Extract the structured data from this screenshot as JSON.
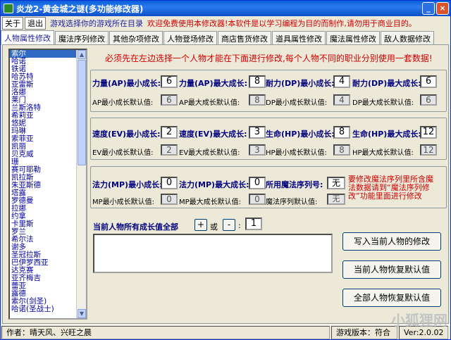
{
  "window": {
    "title": "炎龙2-黄金城之谜(多功能修改器)"
  },
  "menu": {
    "item1": "关于",
    "item2": "退出",
    "hint": "游戏选择你的游戏所在目录",
    "welcome": "欢迎免费使用本修改器!本软件是以学习编程为目的而制作,请勿用于商业目的。"
  },
  "tabs": [
    "人物属性修改",
    "魔法序列修改",
    "其他杂项修改",
    "人物登场修改",
    "商店售货修改",
    "道具属性修改",
    "魔法属性修改",
    "敌人数据修改"
  ],
  "characters": [
    "索尔",
    "哈诺",
    "铁诺",
    "哈苏特",
    "亚雷斯",
    "洛娜",
    "莱门",
    "兰斯洛特",
    "希莉亚",
    "悠妮",
    "玛琳",
    "索菲亚",
    "凯丽",
    "贝克威",
    "珊",
    "赛可耶勒",
    "凯拉斯",
    "朱亚斯德",
    "塔露",
    "罗德曼",
    "拉娜",
    "约拿",
    "卡里斯",
    "罗兰",
    "希尔法",
    "谢多",
    "圣冠拉斯",
    "巴伊罗西亚",
    "达克赛",
    "亚齐梅吉",
    "蕾亚",
    "露德",
    "索尔(剑圣)",
    "哈诺(圣战士)"
  ],
  "selected_index": 0,
  "warning": "必须先在左边选择一个人物才能在下面进行修改,每个人物不同的职业分别使用一套数据!",
  "stats": {
    "ap_min_label": "力量(AP)最小成长:",
    "ap_min": "6",
    "ap_max_label": "力量(AP)最大成长:",
    "ap_max": "8",
    "dp_min_label": "耐力(DP)最小成长:",
    "dp_min": "4",
    "dp_max_label": "耐力(DP)最大成长:",
    "dp_max": "6",
    "ap_min_def_label": "AP最小成长默认值:",
    "ap_min_def": "6",
    "ap_max_def_label": "AP最大成长默认值:",
    "ap_max_def": "8",
    "dp_min_def_label": "DP最小成长默认值:",
    "dp_min_def": "4",
    "dp_max_def_label": "DP最大成长默认值:",
    "dp_max_def": "6",
    "ev_min_label": "速度(EV)最小成长:",
    "ev_min": "2",
    "ev_max_label": "速度(EV)最大成长:",
    "ev_max": "3",
    "hp_min_label": "生命(HP)最小成长:",
    "hp_min": "8",
    "hp_max_label": "生命(HP)最大成长:",
    "hp_max": "12",
    "ev_min_def_label": "EV最小成长默认值:",
    "ev_min_def": "2",
    "ev_max_def_label": "EV最大成长默认值:",
    "ev_max_def": "3",
    "hp_min_def_label": "HP最小成长默认值:",
    "hp_min_def": "8",
    "hp_max_def_label": "HP最大成长默认值:",
    "hp_max_def": "12",
    "mp_min_label": "法力(MP)最小成长:",
    "mp_min": "0",
    "mp_max_label": "法力(MP)最大成长:",
    "mp_max": "0",
    "magic_seq_label": "所用魔法序列号:",
    "magic_seq": "无",
    "mp_min_def_label": "MP最小成长默认值:",
    "mp_min_def": "0",
    "mp_max_def_label": "MP最大成长默认值:",
    "mp_max_def": "0",
    "magic_seq_def_label": "魔法序列默认值:",
    "magic_seq_def": "无",
    "magic_note": "要修改魔法序列里所含魔法数据请到“魔法序列修改”功能里面进行修改"
  },
  "all_growth": {
    "label": "当前人物所有成长值全部",
    "plus": "+",
    "or": "或",
    "minus": "-",
    "colon": ":",
    "value": "1"
  },
  "buttons": {
    "write": "写入当前人物的修改",
    "restore_current": "当前人物恢复默认值",
    "restore_all": "全部人物恢复默认值"
  },
  "status": {
    "author": "作者：晴天风、兴旺之晨",
    "version_label": "游戏版本：符合",
    "version": "Ver:2.0.02"
  },
  "watermark": "小狐狸网"
}
